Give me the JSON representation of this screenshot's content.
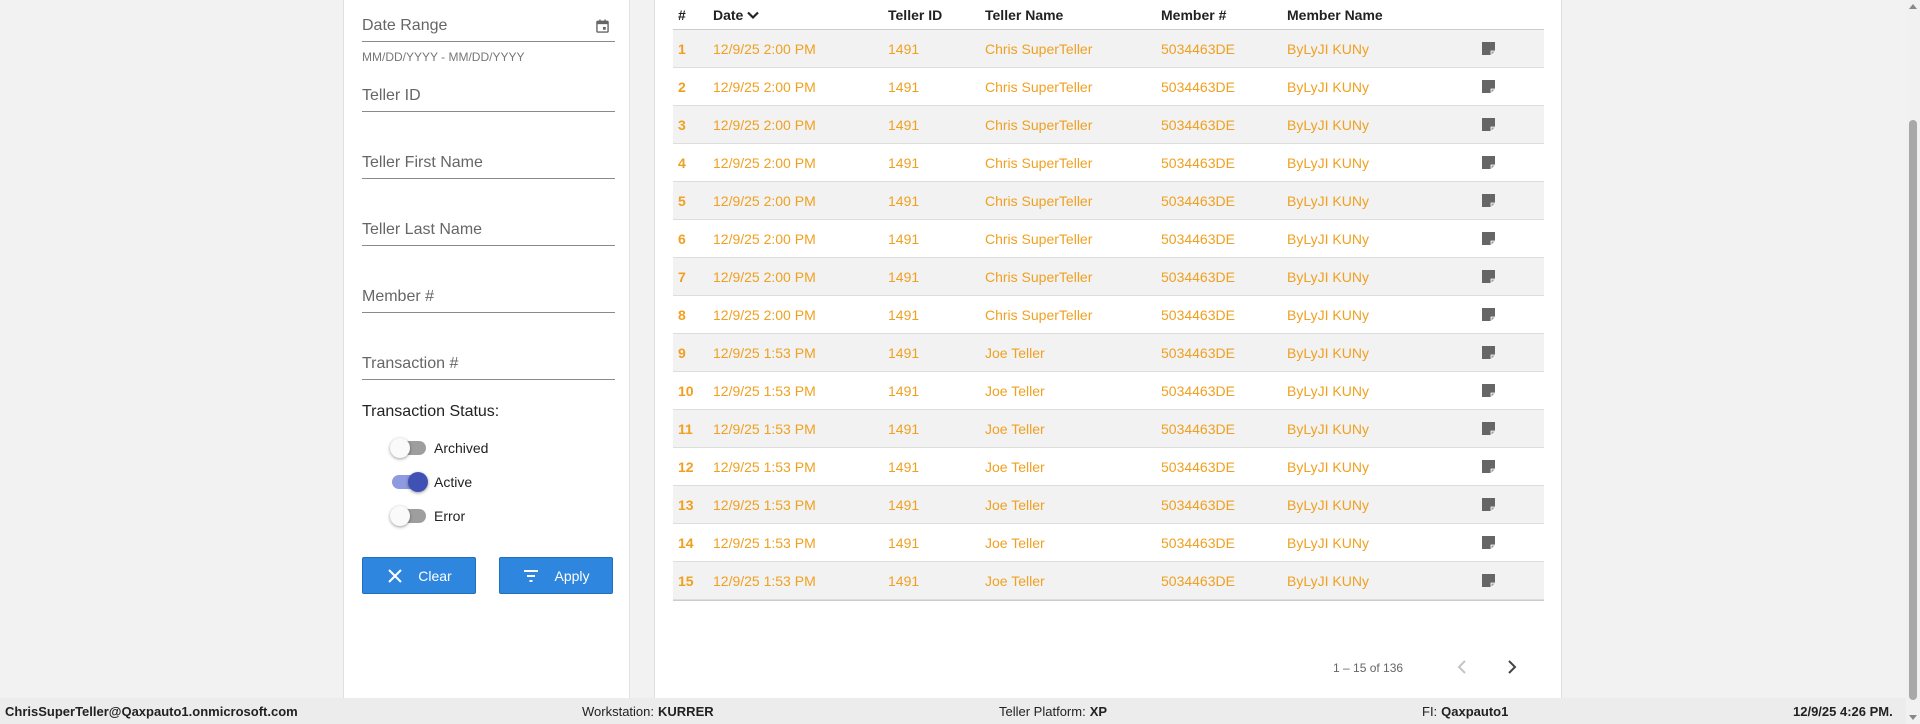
{
  "filters": {
    "date_range": "Date Range",
    "date_hint": "MM/DD/YYYY - MM/DD/YYYY",
    "teller_id": "Teller ID",
    "teller_first": "Teller First Name",
    "teller_last": "Teller Last Name",
    "member": "Member #",
    "transaction": "Transaction #",
    "status_title": "Transaction Status:",
    "toggles": [
      {
        "label": "Archived",
        "on": false
      },
      {
        "label": "Active",
        "on": true
      },
      {
        "label": "Error",
        "on": false
      }
    ],
    "clear_label": "Clear",
    "apply_label": "Apply"
  },
  "table": {
    "headers": [
      "#",
      "Date",
      "Teller ID",
      "Teller Name",
      "Member #",
      "Member Name"
    ],
    "rows": [
      {
        "n": "1",
        "date": "12/9/25 2:00 PM",
        "teller_id": "1491",
        "teller_name": "Chris SuperTeller",
        "member": "5034463DE",
        "member_name": "ByLyJI KUNy"
      },
      {
        "n": "2",
        "date": "12/9/25 2:00 PM",
        "teller_id": "1491",
        "teller_name": "Chris SuperTeller",
        "member": "5034463DE",
        "member_name": "ByLyJI KUNy"
      },
      {
        "n": "3",
        "date": "12/9/25 2:00 PM",
        "teller_id": "1491",
        "teller_name": "Chris SuperTeller",
        "member": "5034463DE",
        "member_name": "ByLyJI KUNy"
      },
      {
        "n": "4",
        "date": "12/9/25 2:00 PM",
        "teller_id": "1491",
        "teller_name": "Chris SuperTeller",
        "member": "5034463DE",
        "member_name": "ByLyJI KUNy"
      },
      {
        "n": "5",
        "date": "12/9/25 2:00 PM",
        "teller_id": "1491",
        "teller_name": "Chris SuperTeller",
        "member": "5034463DE",
        "member_name": "ByLyJI KUNy"
      },
      {
        "n": "6",
        "date": "12/9/25 2:00 PM",
        "teller_id": "1491",
        "teller_name": "Chris SuperTeller",
        "member": "5034463DE",
        "member_name": "ByLyJI KUNy"
      },
      {
        "n": "7",
        "date": "12/9/25 2:00 PM",
        "teller_id": "1491",
        "teller_name": "Chris SuperTeller",
        "member": "5034463DE",
        "member_name": "ByLyJI KUNy"
      },
      {
        "n": "8",
        "date": "12/9/25 2:00 PM",
        "teller_id": "1491",
        "teller_name": "Chris SuperTeller",
        "member": "5034463DE",
        "member_name": "ByLyJI KUNy"
      },
      {
        "n": "9",
        "date": "12/9/25 1:53 PM",
        "teller_id": "1491",
        "teller_name": "Joe Teller",
        "member": "5034463DE",
        "member_name": "ByLyJI KUNy"
      },
      {
        "n": "10",
        "date": "12/9/25 1:53 PM",
        "teller_id": "1491",
        "teller_name": "Joe Teller",
        "member": "5034463DE",
        "member_name": "ByLyJI KUNy"
      },
      {
        "n": "11",
        "date": "12/9/25 1:53 PM",
        "teller_id": "1491",
        "teller_name": "Joe Teller",
        "member": "5034463DE",
        "member_name": "ByLyJI KUNy"
      },
      {
        "n": "12",
        "date": "12/9/25 1:53 PM",
        "teller_id": "1491",
        "teller_name": "Joe Teller",
        "member": "5034463DE",
        "member_name": "ByLyJI KUNy"
      },
      {
        "n": "13",
        "date": "12/9/25 1:53 PM",
        "teller_id": "1491",
        "teller_name": "Joe Teller",
        "member": "5034463DE",
        "member_name": "ByLyJI KUNy"
      },
      {
        "n": "14",
        "date": "12/9/25 1:53 PM",
        "teller_id": "1491",
        "teller_name": "Joe Teller",
        "member": "5034463DE",
        "member_name": "ByLyJI KUNy"
      },
      {
        "n": "15",
        "date": "12/9/25 1:53 PM",
        "teller_id": "1491",
        "teller_name": "Joe Teller",
        "member": "5034463DE",
        "member_name": "ByLyJI KUNy"
      }
    ]
  },
  "pager": {
    "range": "1 – 15 of 136"
  },
  "status_bar": {
    "user": "ChrisSuperTeller@Qaxpauto1.onmicrosoft.com",
    "workstation_label": "Workstation:",
    "workstation": "KURRER",
    "platform_label": "Teller Platform:",
    "platform": "XP",
    "fi_label": "FI:",
    "fi": "Qaxpauto1",
    "datetime": "12/9/25 4:26 PM."
  },
  "colors": {
    "accent_button": "#2e86de",
    "row_text": "#f0a020",
    "toggle_on": "#3f51b5"
  }
}
